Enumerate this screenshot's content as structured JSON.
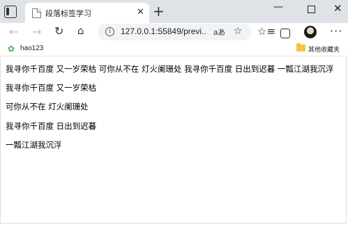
{
  "tab": {
    "title": "段落标签学习",
    "close": "✕",
    "new_tab": "+"
  },
  "window_controls": {
    "minimize": "—",
    "close": "✕"
  },
  "toolbar": {
    "back": "←",
    "forward": "→",
    "reload": "↻",
    "home": "⌂",
    "url": "127.0.0.1:55849/previ...",
    "read_aloud": "aあ",
    "favorite_add": "☆",
    "favorites": "☆≡",
    "menu": "···"
  },
  "bookmarks": {
    "items": [
      {
        "label": "hao123",
        "icon": "hao123-logo-icon"
      }
    ],
    "other_favorites": "其他收藏夹"
  },
  "content": {
    "paragraphs": [
      "我寻你千百度 又一岁荣枯 可你从不在 灯火阑珊处 我寻你千百度 日出到迟暮 一瓢江湖我沉浮",
      "我寻你千百度 又一岁荣枯",
      "可你从不在 灯火阑珊处",
      "我寻你千百度 日出到迟暮",
      "一瓢江湖我沉浮"
    ]
  }
}
